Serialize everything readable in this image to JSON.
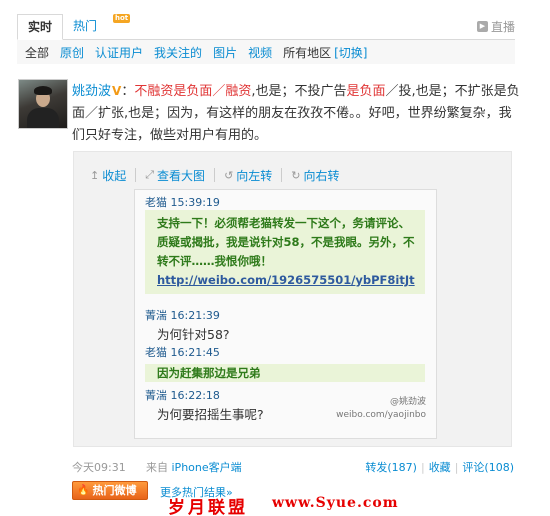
{
  "tabs": {
    "realtime": "实时",
    "hot": "热门",
    "hot_badge": "hot",
    "live": "直播"
  },
  "filters": {
    "all": "全部",
    "original": "原创",
    "verified": "认证用户",
    "following": "我关注的",
    "images": "图片",
    "videos": "视频",
    "region": "所有地区",
    "switch": "[切换]"
  },
  "post": {
    "author": "姚劲波",
    "verified_mark": "V",
    "segments": [
      {
        "text": "：",
        "hl": false
      },
      {
        "text": "不融资是负面／融资",
        "hl": true
      },
      {
        "text": ",也是；不投广告",
        "hl": false
      },
      {
        "text": "是负面",
        "hl": true
      },
      {
        "text": "／投,也是；不扩张是负面／扩张,也是；因为，有这样的朋友在孜孜不倦。。好吧，世界纷繁复杂，我们只好专注，做些对用户有用的。",
        "hl": false
      }
    ]
  },
  "card": {
    "tools": {
      "collapse": "收起",
      "view_large": "查看大图",
      "rotate_left": "向左转",
      "rotate_right": "向右转"
    },
    "chat": {
      "m1_meta": "老猫 15:39:19",
      "m1_text": "支持一下！必须帮老猫转发一下这个，务请评论、质疑或揭批，我是说针对58，不是我眼。另外，不转不评……我恨你哦！",
      "m1_link": "http://weibo.com/1926575501/ybPF8itJt",
      "m2_meta": "菁湍 16:21:39",
      "m2_text": "为何针对58?",
      "m3_meta": "老猫 16:21:45",
      "m3_text": "因为赶集那边是兄弟",
      "m4_meta": "菁湍 16:22:18",
      "m4_text": "为何要招摇生事呢?",
      "watermark_name": "@姚劲波",
      "watermark_url": "weibo.com/yaojinbo"
    }
  },
  "footer": {
    "time": "今天09:31",
    "source_prefix": "来自",
    "source": "iPhone客户端",
    "repost": "转发(187)",
    "favorite": "收藏",
    "comment": "评论(108)"
  },
  "hot_button": "热门微博",
  "more_hot": "更多热门结果»",
  "site_watermark": "岁月联盟",
  "site_watermark_url": "www.Syue.com"
}
